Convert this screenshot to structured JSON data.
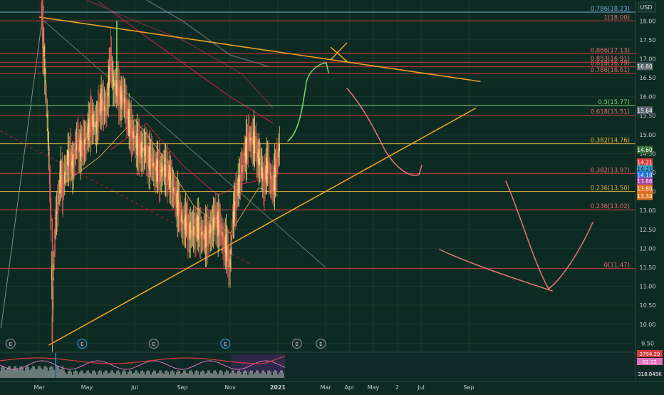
{
  "currency": "USD",
  "colors": {
    "background": "#0d2b22",
    "up": "#e8d070",
    "down": "#e05a5a",
    "fib_line": "#c83a3a",
    "fib_label": "#e26a6a",
    "fib_green": "#7fcf6f",
    "fib_gold": "#e0b040",
    "fib_blue": "#7aa7e0",
    "trend": "#f0a020",
    "drawing_green": "#7fd86a",
    "drawing_pink": "#e87878"
  },
  "chart_data": {
    "type": "candlestick",
    "title": "",
    "ylim": [
      9.3,
      18.55
    ],
    "y_ticks": [
      "18.00",
      "17.50",
      "17.00",
      "16.50",
      "16.00",
      "15.50",
      "15.00",
      "14.50",
      "14.00",
      "13.50",
      "13.00",
      "12.50",
      "12.00",
      "11.50",
      "11.00",
      "10.50",
      "10.00",
      "9.50"
    ],
    "x_ticks": [
      {
        "label": "Mar",
        "t": 0.0
      },
      {
        "label": "May",
        "t": 2.0
      },
      {
        "label": "Jul",
        "t": 4.0
      },
      {
        "label": "Sep",
        "t": 6.0
      },
      {
        "label": "Nov",
        "t": 8.0
      },
      {
        "label": "2021",
        "t": 10.0
      },
      {
        "label": "Mar",
        "t": 12.0
      },
      {
        "label": "Apr",
        "t": 13.0
      },
      {
        "label": "May",
        "t": 14.0
      },
      {
        "label": "2",
        "t": 15.0
      },
      {
        "label": "Jul",
        "t": 16.0
      },
      {
        "label": "Sep",
        "t": 18.0
      }
    ],
    "fib_levels": [
      {
        "label": "0.786(18.23)",
        "value": 18.23,
        "color": "#7aa7e0"
      },
      {
        "label": "1(18.00)",
        "value": 18.0,
        "color": "#e26a6a"
      },
      {
        "label": "0.866(17.13)",
        "value": 17.13,
        "color": "#e26a6a"
      },
      {
        "label": "0.853(16.91)",
        "value": 16.91,
        "color": "#e26a6a"
      },
      {
        "label": "0.618(16.79)",
        "value": 16.79,
        "color": "#e26a6a"
      },
      {
        "label": "0.786(16.61)",
        "value": 16.61,
        "color": "#e26a6a"
      },
      {
        "label": "0.5(15.77)",
        "value": 15.77,
        "color": "#7fcf6f"
      },
      {
        "label": "0.618(15.51)",
        "value": 15.51,
        "color": "#e26a6a"
      },
      {
        "label": "0.382(14.76)",
        "value": 14.76,
        "color": "#e0b040"
      },
      {
        "label": "0.382(13.97)",
        "value": 13.97,
        "color": "#e26a6a"
      },
      {
        "label": "0.236(13.50)",
        "value": 13.5,
        "color": "#e0b040"
      },
      {
        "label": "0.236(13.02)",
        "value": 13.02,
        "color": "#e26a6a"
      },
      {
        "label": "0(11.47)",
        "value": 11.47,
        "color": "#e26a6a"
      }
    ],
    "price_tags": [
      {
        "label": "16.80",
        "value": 16.8,
        "bg": "#5a6470",
        "fg": "#ffffff"
      },
      {
        "label": "15.64",
        "value": 15.64,
        "bg": "#5a6470",
        "fg": "#ffffff"
      },
      {
        "label": "14.60",
        "value": 14.6,
        "bg": "#3a6e3a",
        "fg": "#ffffff"
      },
      {
        "label": "14.21",
        "value": 14.27,
        "bg": "#d83a3a",
        "fg": "#ffffff"
      },
      {
        "label": "14.21",
        "value": 14.09,
        "bg": "#3aa0c8",
        "fg": "#0d1a20"
      },
      {
        "label": "14.18",
        "value": 13.93,
        "bg": "#1d6fd8",
        "fg": "#ffffff"
      },
      {
        "label": "13.86",
        "value": 13.77,
        "bg": "#a040a0",
        "fg": "#ffffff"
      },
      {
        "label": "13.80",
        "value": 13.58,
        "bg": "#e07020",
        "fg": "#ffffff"
      },
      {
        "label": "13.34",
        "value": 13.38,
        "bg": "#e07020",
        "fg": "#ffffff"
      }
    ],
    "price_series": {
      "t": [
        0.1,
        0.2,
        0.3,
        0.4,
        0.5,
        0.55,
        0.6,
        0.7,
        0.8,
        0.9,
        1.0,
        1.2,
        1.4,
        1.6,
        1.8,
        2.0,
        2.2,
        2.4,
        2.6,
        2.8,
        3.0,
        3.1,
        3.2,
        3.4,
        3.6,
        3.8,
        4.0,
        4.2,
        4.4,
        4.6,
        4.8,
        5.0,
        5.2,
        5.4,
        5.6,
        5.8,
        6.0,
        6.2,
        6.4,
        6.6,
        6.8,
        7.0,
        7.2,
        7.4,
        7.6,
        7.8,
        8.0,
        8.1,
        8.2,
        8.4,
        8.6,
        8.8,
        9.0,
        9.2,
        9.4,
        9.6,
        9.8,
        10.0,
        10.1
      ],
      "close": [
        18.3,
        17.2,
        16.0,
        14.5,
        12.8,
        9.9,
        11.5,
        12.8,
        13.2,
        14.0,
        13.6,
        14.4,
        14.2,
        14.8,
        14.6,
        15.0,
        15.4,
        15.2,
        15.9,
        15.6,
        17.0,
        16.4,
        16.3,
        16.0,
        15.9,
        15.2,
        14.9,
        14.6,
        14.6,
        14.4,
        14.2,
        14.0,
        14.1,
        14.0,
        13.6,
        13.2,
        12.7,
        12.6,
        12.4,
        12.6,
        12.4,
        12.3,
        12.5,
        12.8,
        12.5,
        12.1,
        11.6,
        12.6,
        13.2,
        13.8,
        14.4,
        14.9,
        14.8,
        14.4,
        13.8,
        14.2,
        13.6,
        14.4,
        14.8
      ]
    },
    "trendlines": [
      {
        "name": "",
        "points": [
          [
            0.0,
            18.1
          ],
          [
            18.5,
            16.4
          ]
        ]
      },
      {
        "name": "",
        "points": [
          [
            0.4,
            9.45
          ],
          [
            18.3,
            15.7
          ]
        ]
      }
    ],
    "event_markers": [
      "E",
      "E",
      "E",
      "E",
      "E",
      "E"
    ],
    "indicator_tags": [
      {
        "label": "3794.29",
        "bg": "#d83a3a"
      },
      {
        "label": "62.22",
        "bg": "#e070c0"
      },
      {
        "label": "318.845K",
        "bg": "#1a2a30"
      }
    ]
  }
}
